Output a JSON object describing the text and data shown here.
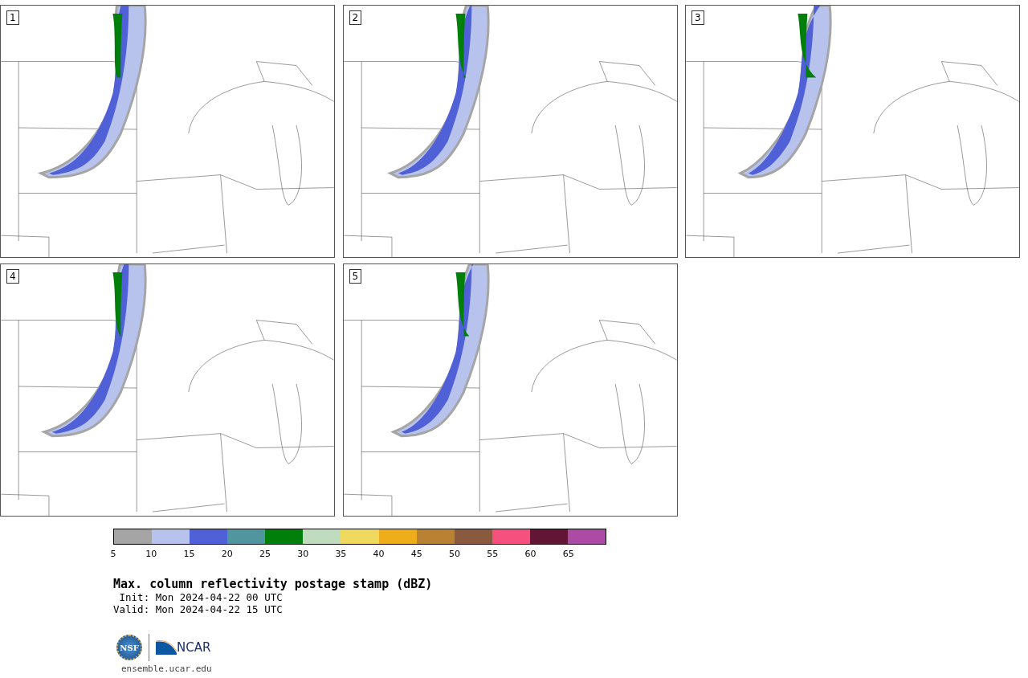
{
  "panels": [
    {
      "label": "1"
    },
    {
      "label": "2"
    },
    {
      "label": "3"
    },
    {
      "label": "4"
    },
    {
      "label": "5"
    }
  ],
  "colorbar": {
    "segments": [
      {
        "color": "#a5a5a5"
      },
      {
        "color": "#b7c3ec"
      },
      {
        "color": "#5060d6"
      },
      {
        "color": "#4f969e"
      },
      {
        "color": "#00800a"
      },
      {
        "color": "#bfdcbf"
      },
      {
        "color": "#efd95e"
      },
      {
        "color": "#eead1a"
      },
      {
        "color": "#b98232"
      },
      {
        "color": "#8a5a3e"
      },
      {
        "color": "#f5507e"
      },
      {
        "color": "#621535"
      },
      {
        "color": "#ab4ba3"
      }
    ],
    "ticks": [
      "5",
      "10",
      "15",
      "20",
      "25",
      "30",
      "35",
      "40",
      "45",
      "50",
      "55",
      "60",
      "65"
    ]
  },
  "title": "Max. column reflectivity postage stamp (dBZ)",
  "init": " Init: Mon 2024-04-22 00 UTC",
  "valid": "Valid: Mon 2024-04-22 15 UTC",
  "logos": {
    "ncar": "NCAR",
    "nsf": "NSF"
  },
  "footer": "ensemble.ucar.edu"
}
